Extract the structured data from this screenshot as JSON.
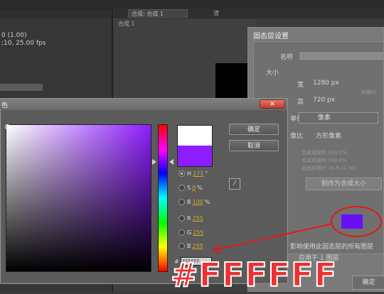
{
  "workspace": {
    "fps_line1": "0 (1.00)",
    "fps_line2": ";10, 25.00 fps",
    "comp_tab_label": "合成: 合成 1",
    "render_tab_label": "渲",
    "comp_sub_label": "合成 1"
  },
  "solid_dialog": {
    "title": "固态层设置",
    "name_label": "名称",
    "size_label": "大小",
    "width_label": "宽",
    "width_value": "1280 px",
    "height_label": "高",
    "height_value": "720 px",
    "lock_text": "纵横比",
    "unit_label": "单位",
    "unit_value": "像素",
    "pixel_aspect_label": "像比",
    "pixel_aspect_value": "方形像素",
    "info_line1": "合成宽度的 100.0%",
    "info_line2": "合成高度的 100.0%",
    "info_line3": "画面纵横比 16:9 (1.78)",
    "make_comp_size_button": "制作为合成大小",
    "affect_all_text": "影响使用此固态层的所有图层",
    "apply_text": "应用于 1 图层",
    "bottom_button": "确定"
  },
  "picker": {
    "title": "色",
    "close_glyph": "×",
    "ok_button": "确定",
    "cancel_button": "取消",
    "eyedropper_glyph": "⁄",
    "h_label": "H",
    "h_value": "271",
    "h_unit": "°",
    "s_label": "S",
    "s_value": "0",
    "s_unit": "%",
    "b_label": "B",
    "b_value": "100",
    "b_unit": "%",
    "r_label": "R",
    "r_value": "255",
    "g_label": "G",
    "g_value": "255",
    "b2_label": "B",
    "b2_value": "255",
    "hex_prefix": "#",
    "hex_value": "FFFFFF",
    "new_color": "#ffffff",
    "old_color": "#8d1dff"
  },
  "annotation": {
    "big_text": "#FFFFFF",
    "color": "#e01a1a"
  }
}
